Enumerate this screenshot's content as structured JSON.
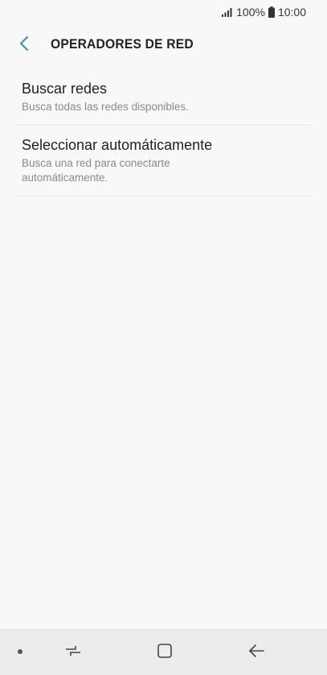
{
  "status_bar": {
    "battery": "100%",
    "time": "10:00",
    "signal_icon": "signal-icon",
    "battery_icon": "battery-icon"
  },
  "header": {
    "title": "OPERADORES DE RED",
    "back_icon": "chevron-left-icon",
    "accent_color": "#4a90b5"
  },
  "items": [
    {
      "title": "Buscar redes",
      "subtitle": "Busca todas las redes disponibles."
    },
    {
      "title": "Seleccionar automáticamente",
      "subtitle": "Busca una red para conectarte automáticamente."
    }
  ],
  "nav_bar": {
    "dot_icon": "dot-icon",
    "recent_icon": "recent-apps-icon",
    "home_icon": "home-icon",
    "back_icon": "back-arrow-icon"
  }
}
